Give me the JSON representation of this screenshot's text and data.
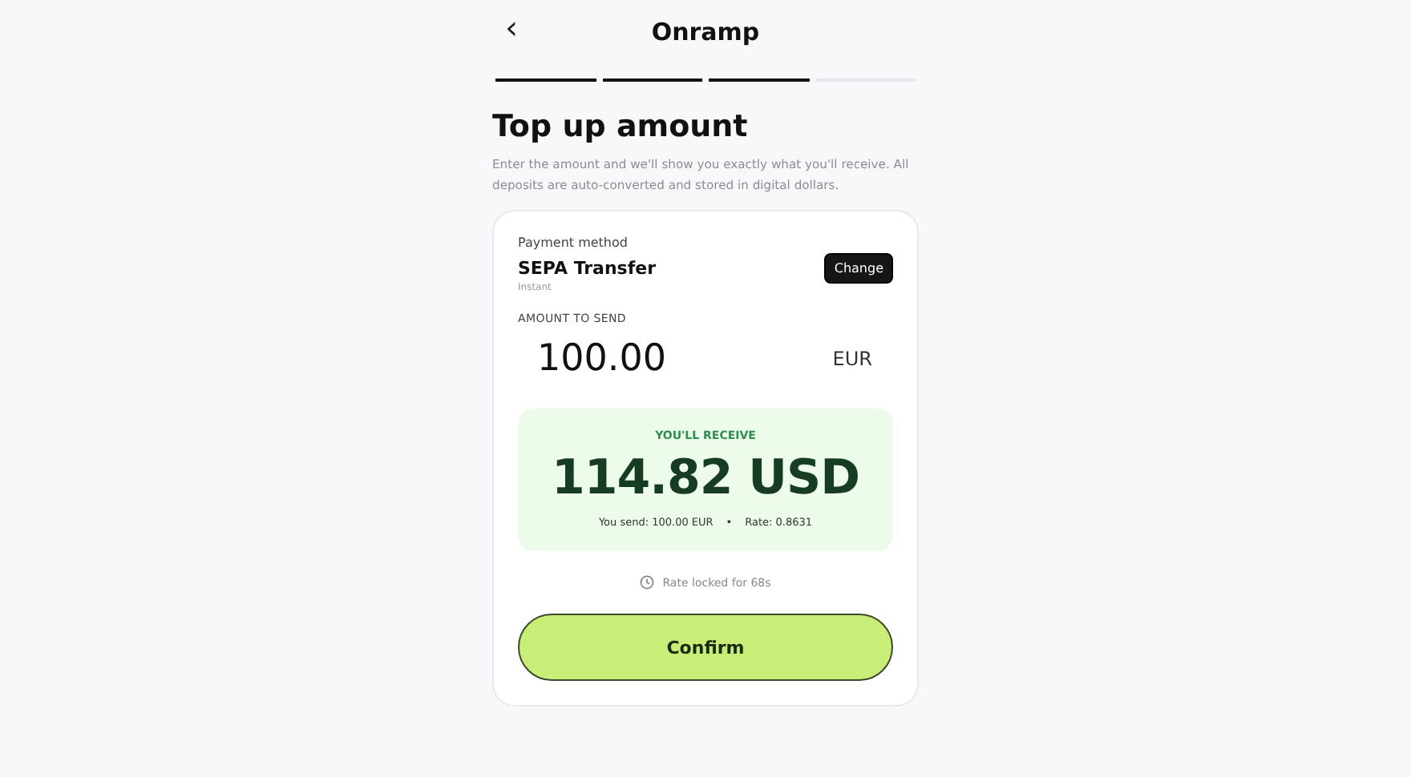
{
  "header": {
    "back": "‹",
    "title": "Onramp"
  },
  "steps": [
    {
      "done": true
    },
    {
      "done": true
    },
    {
      "done": true
    },
    {
      "done": false
    }
  ],
  "heading": "Top up amount",
  "description": "Enter the amount and we'll show you exactly what you'll receive. All deposits are auto-converted and stored in digital dollars.",
  "payment": {
    "label": "Payment method",
    "method": "SEPA Transfer",
    "speed": "Instant",
    "button": "Change"
  },
  "amount": {
    "label": "AMOUNT TO SEND",
    "value": "100.00",
    "currency": "EUR"
  },
  "receive": {
    "label": "YOU'LL RECEIVE",
    "amount": "114.82 USD",
    "send": "You send: 100.00 EUR",
    "separator": "•",
    "rate": "Rate: 0.8631"
  },
  "timer": "Rate locked for 68s",
  "confirm": "Confirm"
}
